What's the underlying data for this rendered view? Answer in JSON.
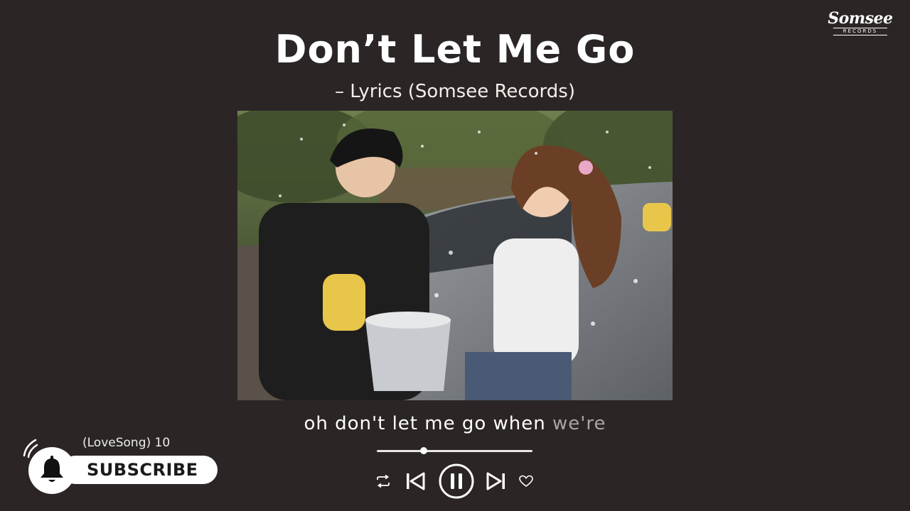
{
  "brand": {
    "logo_text": "Somsee",
    "logo_sub": "RECORDS"
  },
  "song": {
    "title": "Don’t Let Me Go",
    "subtitle": "– Lyrics (Somsee Records)"
  },
  "lyric": {
    "sung": "oh don't let me go when",
    "upcoming": "we're"
  },
  "player": {
    "progress": 0.3
  },
  "channel": {
    "playlist_label": "(LoveSong) 10",
    "subscribe_label": "SUBSCRIBE"
  },
  "icons": {
    "repeat": "repeat-icon",
    "previous": "skip-previous-icon",
    "pause": "pause-icon",
    "next": "skip-next-icon",
    "like": "heart-icon",
    "bell": "bell-icon"
  },
  "colors": {
    "background": "#2b2625",
    "text": "#ffffff",
    "dim_lyric": "#a9a5a2"
  }
}
